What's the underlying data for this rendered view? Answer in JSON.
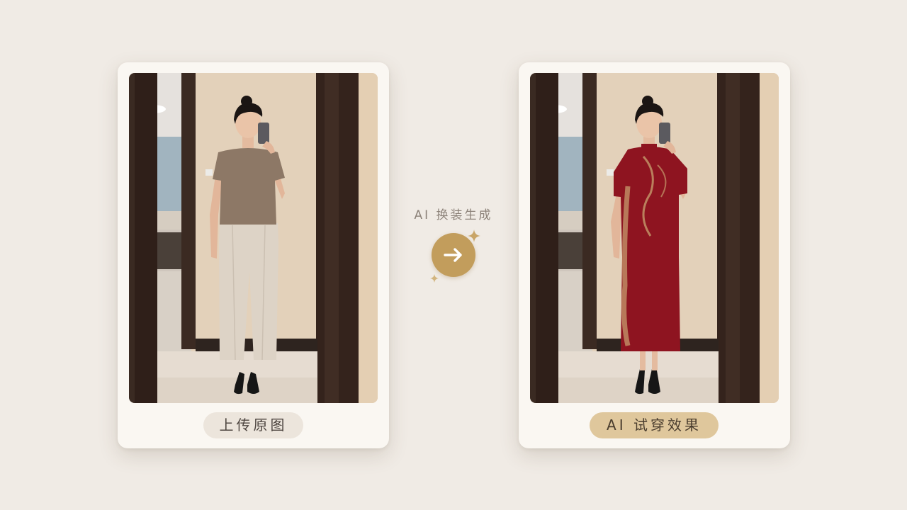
{
  "left_panel": {
    "caption": "上传原图"
  },
  "center": {
    "label": "AI 换装生成",
    "arrow_icon": "arrow-right-icon"
  },
  "right_panel": {
    "caption": "AI 试穿效果"
  },
  "colors": {
    "background": "#f0ebe5",
    "card": "#faf7f2",
    "accent_gold": "#c29d5c",
    "badge_gold": "#dfc79c",
    "badge_neutral": "#ece5dc",
    "dress_red": "#8e1420"
  }
}
